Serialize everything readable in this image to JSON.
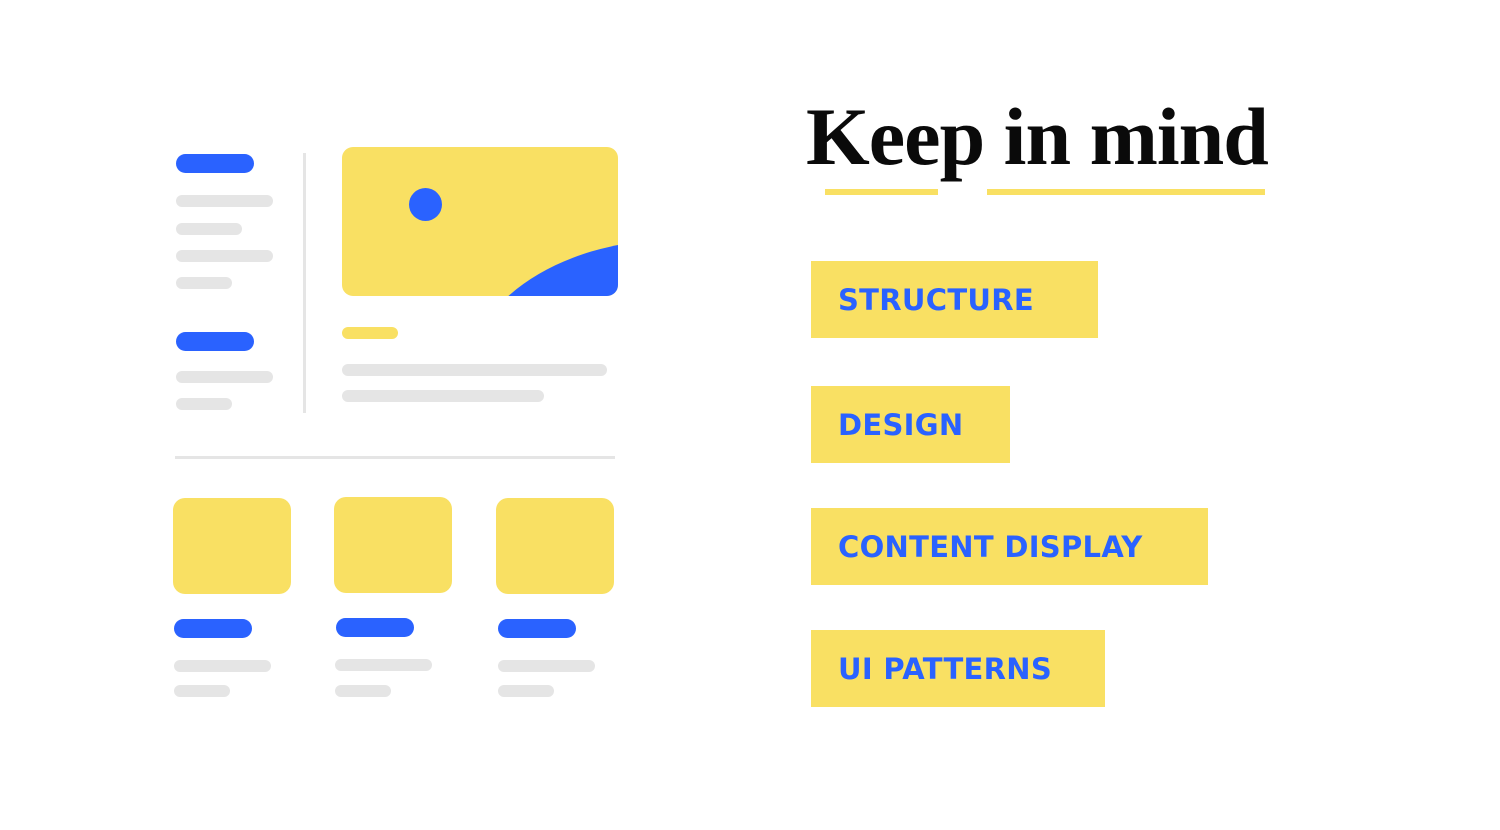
{
  "heading": {
    "title": "Keep in mind",
    "underline_color": "#F9E063"
  },
  "topics": [
    {
      "label": "STRUCTURE"
    },
    {
      "label": "DESIGN"
    },
    {
      "label": "CONTENT DISPLAY"
    },
    {
      "label": "UI PATTERNS"
    }
  ],
  "palette": {
    "accent_blue": "#2A62FF",
    "accent_yellow": "#F9E063",
    "placeholder_grey": "#E5E5E5",
    "text_dark": "#0a0a0a"
  },
  "illustration": {
    "description": "wireframe layout mockup",
    "sidebar_groups": 2,
    "card_count": 3,
    "hero_image_icon": "image-placeholder-icon"
  }
}
